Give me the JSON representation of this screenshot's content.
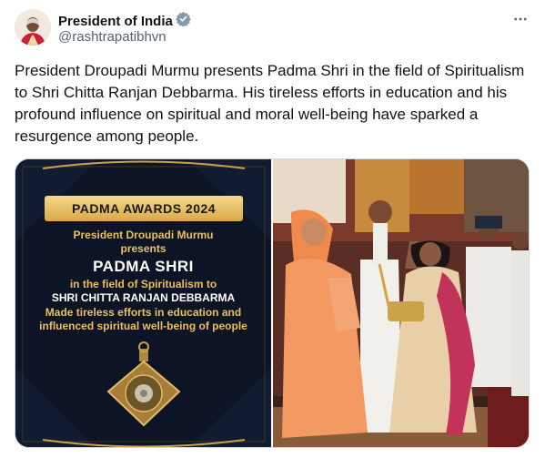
{
  "author": {
    "display_name": "President of India",
    "handle": "@rashtrapatibhvn",
    "verified_icon": "gov-verified-badge-icon"
  },
  "more_icon": "more-options-icon",
  "tweet": {
    "text": "President Droupadi Murmu presents Padma Shri in the field of Spiritualism to Shri Chitta Ranjan Debbarma. His tireless efforts in education and his profound influence on spiritual and moral well-being have sparked a resurgence among people."
  },
  "card": {
    "tag": "PADMA AWARDS 2024",
    "line1": "President Droupadi Murmu",
    "line2": "presents",
    "award": "PADMA SHRI",
    "field": "in the field of Spiritualism to",
    "recipient": "SHRI CHITTA RANJAN DEBBARMA",
    "desc1": "Made tireless efforts in education and",
    "desc2": "influenced spiritual well-being of people",
    "colors": {
      "bg": "#0c1426",
      "gold": "#e9c05d"
    }
  },
  "photo": {
    "icon": "award-ceremony-photo"
  }
}
